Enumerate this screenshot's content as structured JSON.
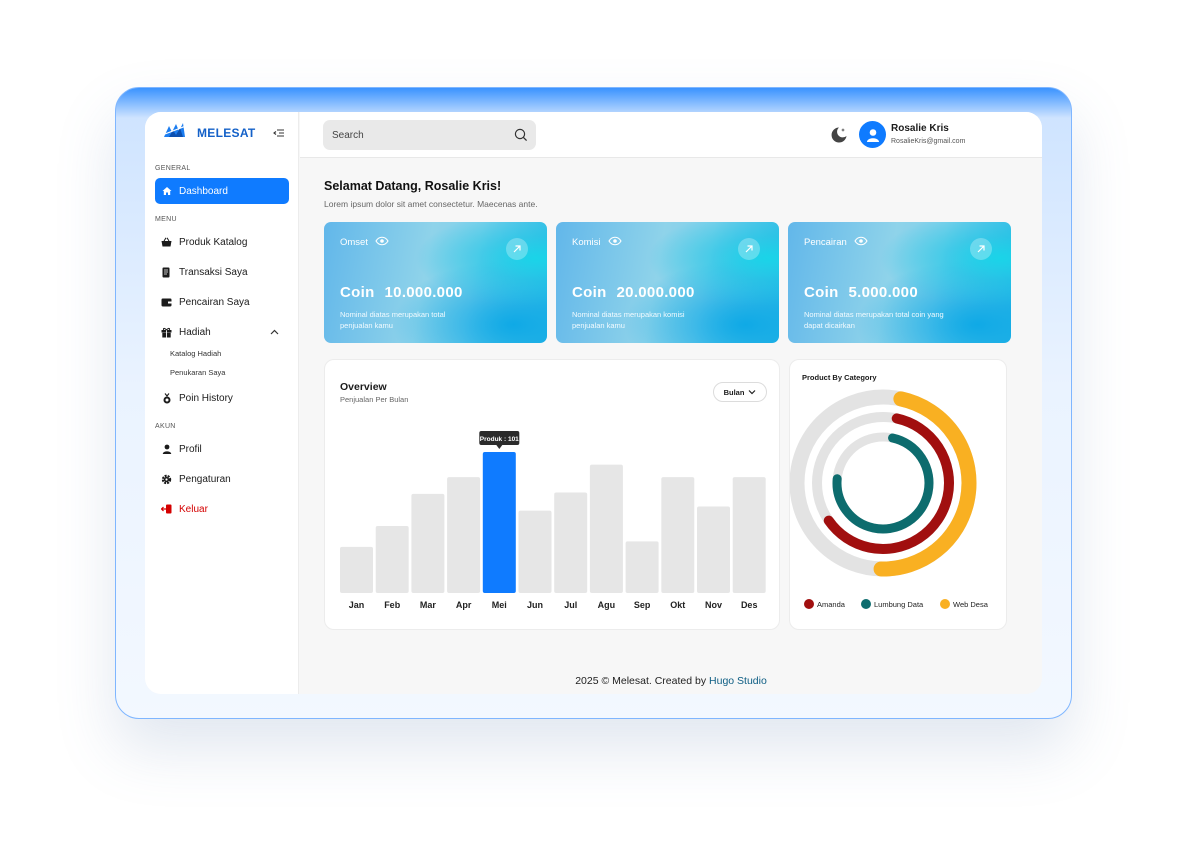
{
  "app": {
    "name": "MELESAT",
    "accent_color": "#0f7bff",
    "danger_color": "#d40000"
  },
  "sidebar": {
    "sections": [
      {
        "label": "GENERAL"
      },
      {
        "label": "MENU"
      },
      {
        "label": "AKUN"
      }
    ],
    "items": {
      "dashboard": {
        "label": "Dashboard",
        "icon": "home-icon",
        "active": true
      },
      "produk_katalog": {
        "label": "Produk Katalog",
        "icon": "basket-icon"
      },
      "transaksi_saya": {
        "label": "Transaksi Saya",
        "icon": "receipt-icon"
      },
      "pencairan_saya": {
        "label": "Pencairan Saya",
        "icon": "wallet-icon"
      },
      "hadiah": {
        "label": "Hadiah",
        "icon": "gift-icon",
        "expanded": true,
        "children": [
          {
            "label": "Katalog Hadiah"
          },
          {
            "label": "Penukaran Saya"
          }
        ]
      },
      "poin_history": {
        "label": "Poin History",
        "icon": "medal-icon"
      },
      "profil": {
        "label": "Profil",
        "icon": "user-icon"
      },
      "pengaturan": {
        "label": "Pengaturan",
        "icon": "gear-icon"
      },
      "keluar": {
        "label": "Keluar",
        "icon": "logout-icon"
      }
    }
  },
  "header": {
    "search_placeholder": "Search",
    "user": {
      "name": "Rosalie Kris",
      "email": "RosalieKris@gmail.com"
    }
  },
  "welcome": {
    "title": "Selamat Datang, Rosalie Kris!",
    "subtitle": "Lorem ipsum dolor sit amet consectetur. Maecenas ante."
  },
  "stats": [
    {
      "label": "Omset",
      "prefix": "Coin",
      "value": "10.000.000",
      "desc": "Nominal diatas merupakan total penjualan kamu"
    },
    {
      "label": "Komisi",
      "prefix": "Coin",
      "value": "20.000.000",
      "desc": "Nominal diatas merupakan komisi penjualan kamu"
    },
    {
      "label": "Pencairan",
      "prefix": "Coin",
      "value": "5.000.000",
      "desc": "Nominal diatas merupakan total coin yang dapat dicairkan"
    }
  ],
  "overview": {
    "title": "Overview",
    "subtitle": "Penjualan Per Bulan",
    "period_select": "Bulan",
    "tooltip": "Produk : 101"
  },
  "chart_data": [
    {
      "type": "bar",
      "title": "Overview",
      "subtitle": "Penjualan Per Bulan",
      "categories": [
        "Jan",
        "Feb",
        "Mar",
        "Apr",
        "Mei",
        "Jun",
        "Jul",
        "Agu",
        "Sep",
        "Okt",
        "Nov",
        "Des"
      ],
      "values": [
        33,
        48,
        71,
        83,
        101,
        59,
        72,
        92,
        37,
        83,
        62,
        83
      ],
      "highlight_index": 4,
      "highlight_color": "#0f7bff",
      "bar_color": "#e6e6e6",
      "ylim": [
        0,
        101
      ],
      "grid": false
    },
    {
      "type": "pie",
      "title": "Product By Category",
      "style": "concentric-rings",
      "series": [
        {
          "name": "Web Desa",
          "value": 0.47,
          "color": "#f9b022"
        },
        {
          "name": "Amanda",
          "value": 0.62,
          "color": "#a10f0f"
        },
        {
          "name": "Lumbung Data",
          "value": 0.73,
          "color": "#0d6c6e"
        }
      ],
      "track_color": "#e3e3e3",
      "legend_position": "bottom"
    }
  ],
  "category": {
    "title": "Product By Category",
    "legend": [
      {
        "label": "Amanda",
        "color": "#a10f0f"
      },
      {
        "label": "Lumbung Data",
        "color": "#0d6c6e"
      },
      {
        "label": "Web Desa",
        "color": "#f9b022"
      }
    ]
  },
  "footer": {
    "text": "2025 © Melesat. Created by",
    "brand": "Hugo Studio"
  }
}
